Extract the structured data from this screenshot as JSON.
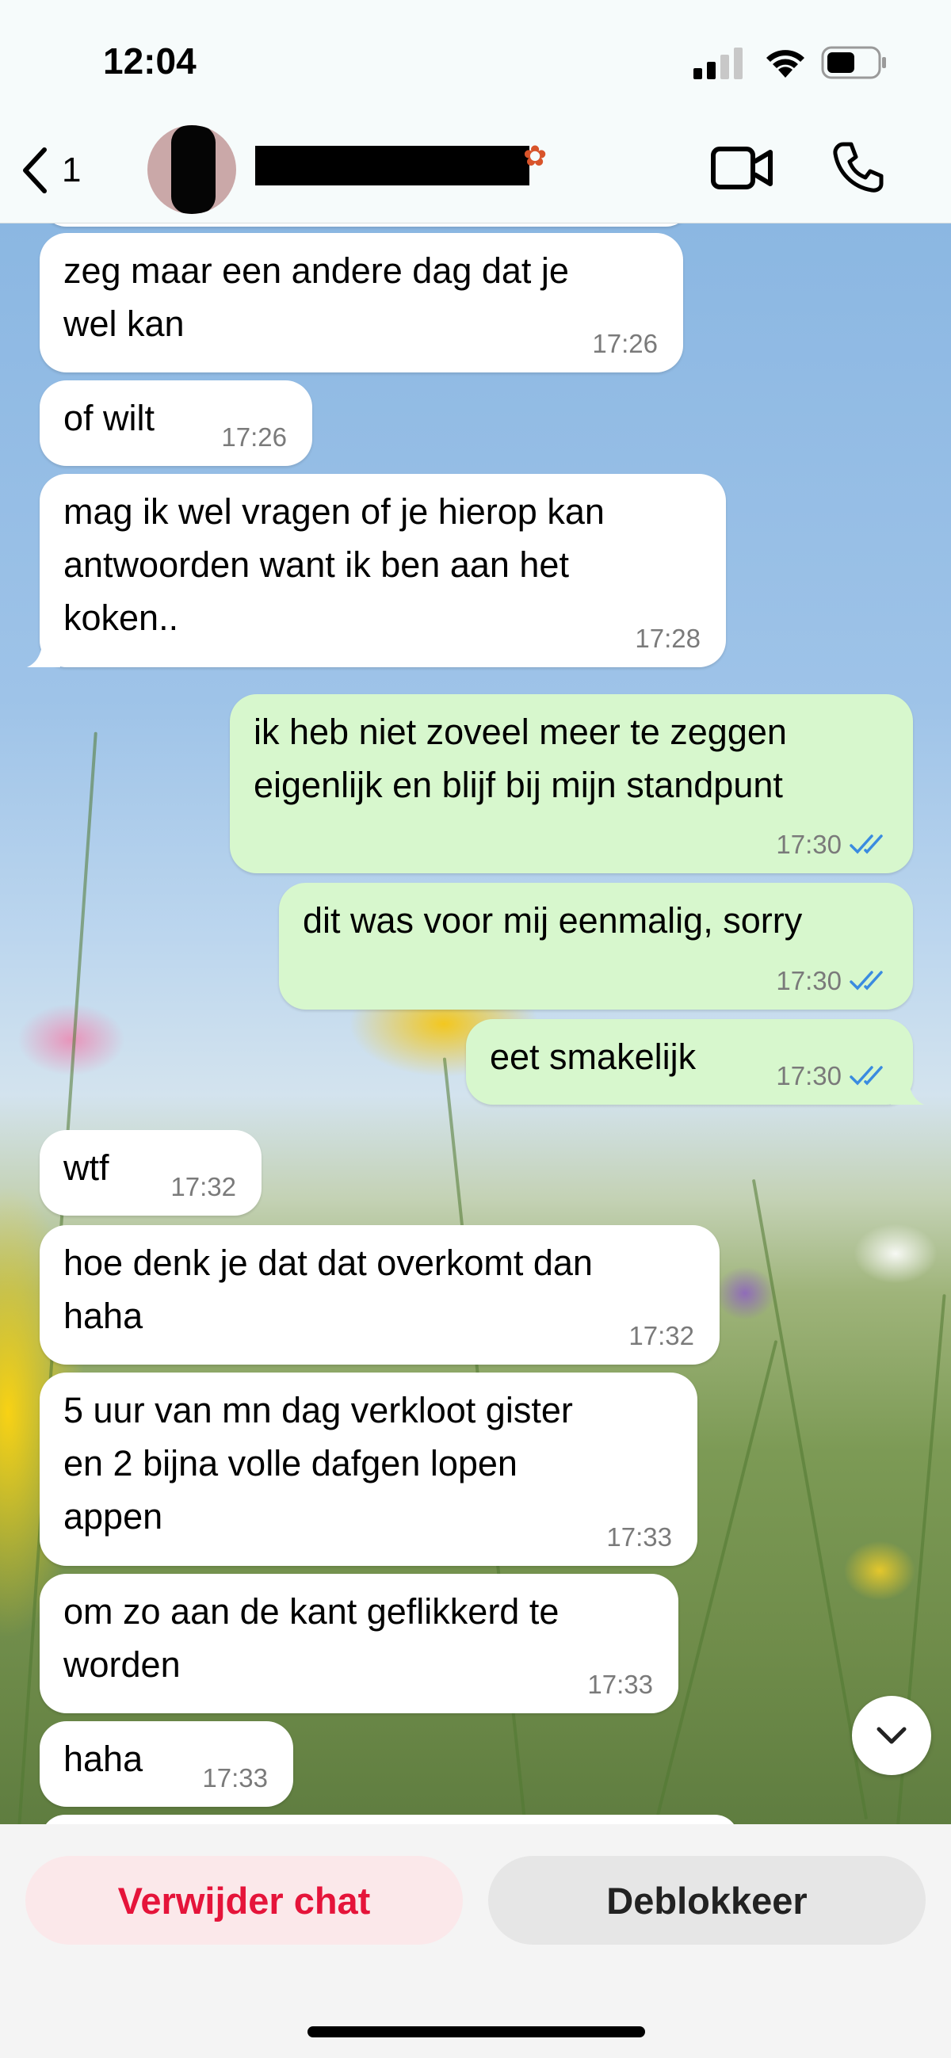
{
  "status_bar": {
    "time": "12:04"
  },
  "header": {
    "back_count": "1",
    "contact_name": "",
    "icons": [
      "chevron-left-icon",
      "video-call-icon",
      "phone-icon"
    ]
  },
  "messages": [
    {
      "direction": "in",
      "text_lines": [
        "zeg maar een andere dag dat je",
        "wel kan"
      ],
      "time": "17:26"
    },
    {
      "direction": "in",
      "text_lines": [
        "of wilt"
      ],
      "time": "17:26"
    },
    {
      "direction": "in",
      "text_lines": [
        "mag ik wel vragen of je hierop kan",
        "antwoorden want ik ben aan het",
        "koken.."
      ],
      "time": "17:28"
    },
    {
      "direction": "out",
      "text_lines": [
        "ik heb niet zoveel meer te zeggen",
        "eigenlijk en blijf bij mijn standpunt"
      ],
      "time": "17:30",
      "read": true
    },
    {
      "direction": "out",
      "text_lines": [
        "dit was voor mij eenmalig, sorry"
      ],
      "time": "17:30",
      "read": true
    },
    {
      "direction": "out",
      "text_lines": [
        "eet smakelijk"
      ],
      "time": "17:30",
      "read": true
    },
    {
      "direction": "in",
      "text_lines": [
        "wtf"
      ],
      "time": "17:32"
    },
    {
      "direction": "in",
      "text_lines": [
        "hoe denk je dat dat overkomt dan",
        "haha"
      ],
      "time": "17:32"
    },
    {
      "direction": "in",
      "text_lines": [
        "5 uur van mn dag verkloot gister",
        "en 2 bijna volle dafgen lopen",
        "appen"
      ],
      "time": "17:33"
    },
    {
      "direction": "in",
      "text_lines": [
        "om zo aan de kant geflikkerd te",
        "worden"
      ],
      "time": "17:33"
    },
    {
      "direction": "in",
      "text_lines": [
        "haha"
      ],
      "time": "17:33"
    }
  ],
  "bottom_bar": {
    "delete_label": "Verwijder chat",
    "unblock_label": "Deblokkeer"
  },
  "colors": {
    "incoming_bubble": "#ffffff",
    "outgoing_bubble": "#d7f7cd",
    "read_ticks": "#3a8be0",
    "delete_text": "#e5143a"
  }
}
